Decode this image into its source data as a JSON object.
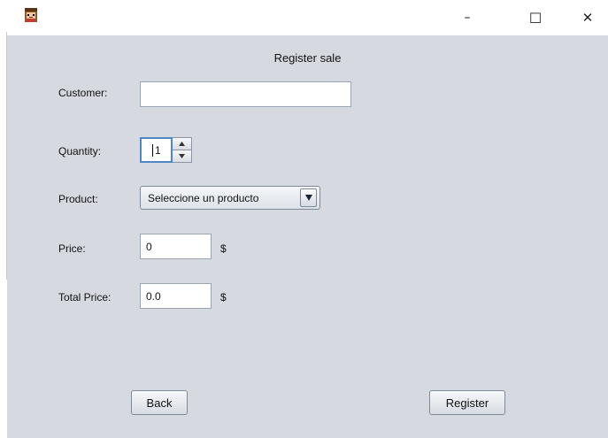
{
  "window": {
    "minimize_glyph": "–",
    "maximize_glyph": "☐",
    "close_glyph": "✕"
  },
  "form": {
    "title": "Register sale",
    "customer_label": "Customer:",
    "customer_value": "",
    "quantity_label": "Quantity:",
    "quantity_value": "1",
    "product_label": "Product:",
    "product_selected": "Seleccione un producto",
    "price_label": "Price:",
    "price_value": "0",
    "price_currency": "$",
    "total_label": "Total Price:",
    "total_value": "0.0",
    "total_currency": "$"
  },
  "buttons": {
    "back": "Back",
    "register": "Register"
  },
  "icons": {
    "app": "app-icon",
    "spin_up": "arrow-up-icon",
    "spin_down": "arrow-down-icon",
    "dropdown": "dropdown-arrow-icon"
  }
}
